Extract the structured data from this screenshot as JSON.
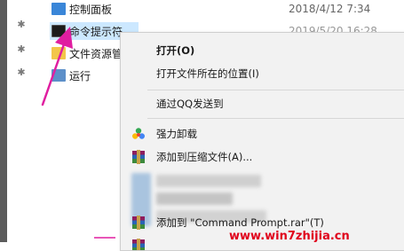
{
  "files": [
    {
      "name": "控制面板",
      "date": "2018/4/12 7:34",
      "icon": "control-panel-icon"
    },
    {
      "name": "命令提示符",
      "date": "2019/5/20 16:28",
      "icon": "cmd-icon"
    },
    {
      "name": "文件资源管",
      "date": "",
      "icon": "file-explorer-icon"
    },
    {
      "name": "运行",
      "date": "",
      "icon": "run-icon"
    }
  ],
  "context_menu": {
    "open": "打开(O)",
    "open_location": "打开文件所在的位置(I)",
    "send_qq": "通过QQ发送到",
    "uninstall": "强力卸载",
    "add_archive": "添加到压缩文件(A)...",
    "add_rar": "添加到 \"Command Prompt.rar\"(T)"
  },
  "watermark": "www.win7zhijia.cn",
  "colors": {
    "arrow": "#e01ea0",
    "selection": "#cce8ff",
    "watermark": "#e0001b"
  }
}
